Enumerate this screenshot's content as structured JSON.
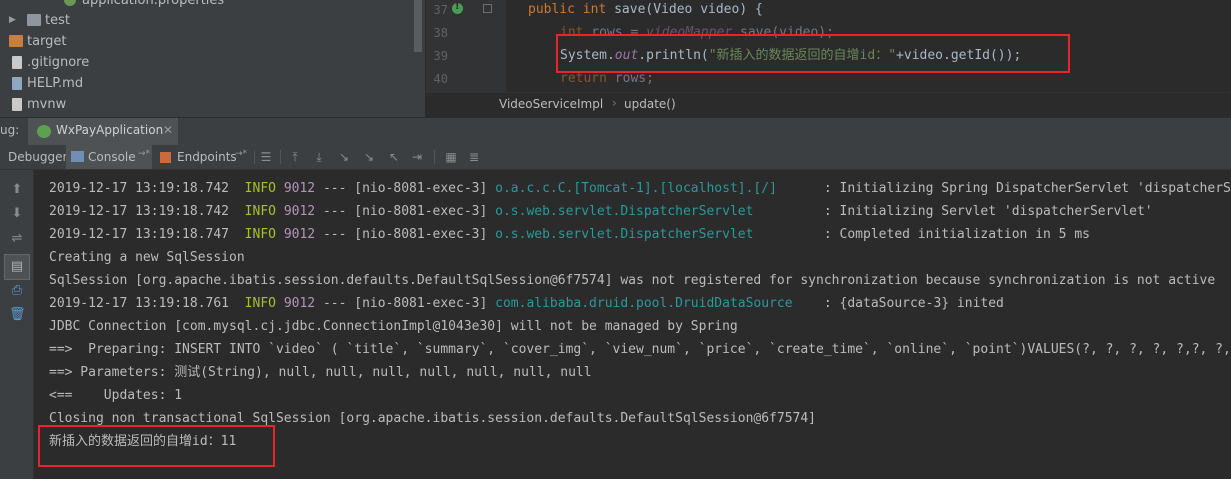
{
  "project_tree": {
    "items": [
      {
        "label": "application.properties",
        "has_arrow": false
      },
      {
        "label": "test",
        "has_arrow": true
      },
      {
        "label": "target",
        "has_arrow": false
      },
      {
        "label": ".gitignore",
        "has_arrow": false
      },
      {
        "label": "HELP.md",
        "has_arrow": false
      },
      {
        "label": "mvnw",
        "has_arrow": false
      }
    ]
  },
  "editor": {
    "line_numbers": [
      "37",
      "38",
      "39",
      "40"
    ],
    "line37": {
      "kw1": "public",
      "kw2": "int",
      "rest": " save(Video video) {"
    },
    "line38": {
      "kw": "int",
      "var": " rows = ",
      "field": "videoMapper",
      "rest": ".save(video);"
    },
    "line39": {
      "pre": "System.",
      "field": "out",
      "mid": ".println(",
      "str": "\"新插入的数据返回的自增id：\"",
      "post": "+video.getId());"
    },
    "line40": {
      "kw": "return",
      "rest": " rows;"
    },
    "breadcrumbs": [
      "VideoServiceImpl",
      "update()"
    ]
  },
  "debug": {
    "title_prefix": "ug:",
    "app_tab": "WxPayApplication",
    "tabs": {
      "debugger": "Debugger",
      "console": "Console",
      "endpoints": "Endpoints"
    }
  },
  "console": {
    "lines": [
      {
        "date": "2019-12-17 13:19:18.742",
        "level": "INFO",
        "pid": "9012",
        "thread": " --- [nio-8081-exec-3] ",
        "logger": "o.a.c.c.C.[Tomcat-1].[localhost].[/]",
        "msg": " : Initializing Spring DispatcherServlet 'dispatcherServlet'"
      },
      {
        "date": "2019-12-17 13:19:18.742",
        "level": "INFO",
        "pid": "9012",
        "thread": " --- [nio-8081-exec-3] ",
        "logger": "o.s.web.servlet.DispatcherServlet",
        "msg": " : Initializing Servlet 'dispatcherServlet'"
      },
      {
        "date": "2019-12-17 13:19:18.747",
        "level": "INFO",
        "pid": "9012",
        "thread": " --- [nio-8081-exec-3] ",
        "logger": "o.s.web.servlet.DispatcherServlet",
        "msg": " : Completed initialization in 5 ms"
      },
      {
        "text": "Creating a new SqlSession"
      },
      {
        "text": "SqlSession [org.apache.ibatis.session.defaults.DefaultSqlSession@6f7574] was not registered for synchronization because synchronization is not active"
      },
      {
        "date": "2019-12-17 13:19:18.761",
        "level": "INFO",
        "pid": "9012",
        "thread": " --- [nio-8081-exec-3] ",
        "logger": "com.alibaba.druid.pool.DruidDataSource",
        "msg": " : {dataSource-3} inited"
      },
      {
        "text": "JDBC Connection [com.mysql.cj.jdbc.ConnectionImpl@1043e30] will not be managed by Spring"
      },
      {
        "text": "==>  Preparing: INSERT INTO `video` ( `title`, `summary`, `cover_img`, `view_num`, `price`, `create_time`, `online`, `point`)VALUES(?, ?, ?, ?, ?,?, ?, ?)"
      },
      {
        "text": "==> Parameters: 测试(String), null, null, null, null, null, null, null"
      },
      {
        "text": "<==    Updates: 1"
      },
      {
        "text": "Closing non transactional SqlSession [org.apache.ibatis.session.defaults.DefaultSqlSession@6f7574]"
      },
      {
        "text": "新插入的数据返回的自增id：11"
      }
    ]
  },
  "colors": {
    "highlight_box": "#e8262a",
    "info": "#a8c023",
    "logger": "#299999",
    "pid": "#b294bb",
    "keyword": "#cc7832",
    "string": "#6a8759"
  }
}
